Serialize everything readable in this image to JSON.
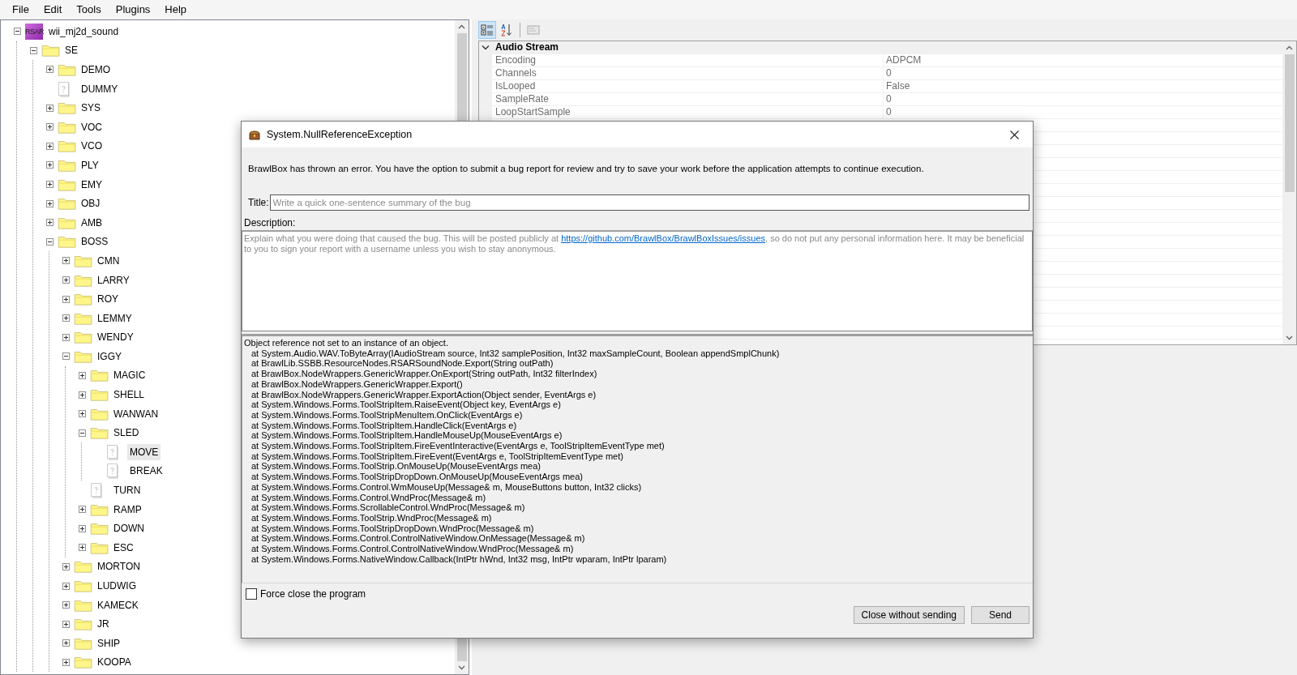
{
  "menu": [
    "File",
    "Edit",
    "Tools",
    "Plugins",
    "Help"
  ],
  "tree": {
    "label": "wii_mj2d_sound",
    "kind": "archive",
    "icon_text": "RSAR",
    "expanded": true,
    "selected": false,
    "children": [
      {
        "label": "SE",
        "kind": "folder",
        "expanded": true,
        "selected": false,
        "children": [
          {
            "label": "DEMO",
            "kind": "folder",
            "expanded": false,
            "selected": false
          },
          {
            "label": "DUMMY",
            "kind": "sound",
            "selected": false
          },
          {
            "label": "SYS",
            "kind": "folder",
            "expanded": false,
            "selected": false
          },
          {
            "label": "VOC",
            "kind": "folder",
            "expanded": false,
            "selected": false
          },
          {
            "label": "VCO",
            "kind": "folder",
            "expanded": false,
            "selected": false
          },
          {
            "label": "PLY",
            "kind": "folder",
            "expanded": false,
            "selected": false
          },
          {
            "label": "EMY",
            "kind": "folder",
            "expanded": false,
            "selected": false
          },
          {
            "label": "OBJ",
            "kind": "folder",
            "expanded": false,
            "selected": false
          },
          {
            "label": "AMB",
            "kind": "folder",
            "expanded": false,
            "selected": false
          },
          {
            "label": "BOSS",
            "kind": "folder",
            "expanded": true,
            "selected": false,
            "children": [
              {
                "label": "CMN",
                "kind": "folder",
                "expanded": false,
                "selected": false
              },
              {
                "label": "LARRY",
                "kind": "folder",
                "expanded": false,
                "selected": false
              },
              {
                "label": "ROY",
                "kind": "folder",
                "expanded": false,
                "selected": false
              },
              {
                "label": "LEMMY",
                "kind": "folder",
                "expanded": false,
                "selected": false
              },
              {
                "label": "WENDY",
                "kind": "folder",
                "expanded": false,
                "selected": false
              },
              {
                "label": "IGGY",
                "kind": "folder",
                "expanded": true,
                "selected": false,
                "children": [
                  {
                    "label": "MAGIC",
                    "kind": "folder",
                    "expanded": false,
                    "selected": false
                  },
                  {
                    "label": "SHELL",
                    "kind": "folder",
                    "expanded": false,
                    "selected": false
                  },
                  {
                    "label": "WANWAN",
                    "kind": "folder",
                    "expanded": false,
                    "selected": false
                  },
                  {
                    "label": "SLED",
                    "kind": "folder",
                    "expanded": true,
                    "selected": false,
                    "children": [
                      {
                        "label": "MOVE",
                        "kind": "sound",
                        "selected": true
                      },
                      {
                        "label": "BREAK",
                        "kind": "sound",
                        "selected": false
                      }
                    ]
                  },
                  {
                    "label": "TURN",
                    "kind": "sound",
                    "selected": false
                  },
                  {
                    "label": "RAMP",
                    "kind": "folder",
                    "expanded": false,
                    "selected": false
                  },
                  {
                    "label": "DOWN",
                    "kind": "folder",
                    "expanded": false,
                    "selected": false
                  },
                  {
                    "label": "ESC",
                    "kind": "folder",
                    "expanded": false,
                    "selected": false
                  }
                ]
              },
              {
                "label": "MORTON",
                "kind": "folder",
                "expanded": false,
                "selected": false
              },
              {
                "label": "LUDWIG",
                "kind": "folder",
                "expanded": false,
                "selected": false
              },
              {
                "label": "KAMECK",
                "kind": "folder",
                "expanded": false,
                "selected": false
              },
              {
                "label": "JR",
                "kind": "folder",
                "expanded": false,
                "selected": false
              },
              {
                "label": "SHIP",
                "kind": "folder",
                "expanded": false,
                "selected": false
              },
              {
                "label": "KOOPA",
                "kind": "folder",
                "expanded": false,
                "selected": false
              }
            ]
          }
        ]
      }
    ]
  },
  "property_grid": {
    "toolbar": [
      {
        "kind": "categorized",
        "selected": true
      },
      {
        "kind": "alphabetical",
        "selected": false
      },
      {
        "kind": "pages",
        "selected": false
      }
    ],
    "categories": [
      {
        "name": "Audio Stream",
        "expanded": true,
        "properties": [
          {
            "name": "Encoding",
            "value": "ADPCM"
          },
          {
            "name": "Channels",
            "value": "0"
          },
          {
            "name": "IsLooped",
            "value": "False"
          },
          {
            "name": "SampleRate",
            "value": "0"
          },
          {
            "name": "LoopStartSample",
            "value": "0"
          }
        ]
      }
    ]
  },
  "dialog": {
    "title": "System.NullReferenceException",
    "message": "BrawlBox has thrown an error. You have the option to submit a bug report for review and try to save your work before the application attempts to continue execution.",
    "title_label": "Title:",
    "title_placeholder": "Write a quick one-sentence summary of the bug",
    "description_label": "Description:",
    "description_hint": {
      "before": "Explain what you were doing that caused the bug. This will be posted publicly at ",
      "link": "https://github.com/BrawlBox/BrawlBoxIssues/issues",
      "after": ", so do not put any personal information here. It may be beneficial to you to sign your report with a username unless you wish to stay anonymous."
    },
    "exception_message": "Object reference not set to an instance of an object.",
    "stack_frames": [
      "at System.Audio.WAV.ToByteArray(IAudioStream source, Int32 samplePosition, Int32 maxSampleCount, Boolean appendSmplChunk)",
      "at BrawlLib.SSBB.ResourceNodes.RSARSoundNode.Export(String outPath)",
      "at BrawlBox.NodeWrappers.GenericWrapper.OnExport(String outPath, Int32 filterIndex)",
      "at BrawlBox.NodeWrappers.GenericWrapper.Export()",
      "at BrawlBox.NodeWrappers.GenericWrapper.ExportAction(Object sender, EventArgs e)",
      "at System.Windows.Forms.ToolStripItem.RaiseEvent(Object key, EventArgs e)",
      "at System.Windows.Forms.ToolStripMenuItem.OnClick(EventArgs e)",
      "at System.Windows.Forms.ToolStripItem.HandleClick(EventArgs e)",
      "at System.Windows.Forms.ToolStripItem.HandleMouseUp(MouseEventArgs e)",
      "at System.Windows.Forms.ToolStripItem.FireEventInteractive(EventArgs e, ToolStripItemEventType met)",
      "at System.Windows.Forms.ToolStripItem.FireEvent(EventArgs e, ToolStripItemEventType met)",
      "at System.Windows.Forms.ToolStrip.OnMouseUp(MouseEventArgs mea)",
      "at System.Windows.Forms.ToolStripDropDown.OnMouseUp(MouseEventArgs mea)",
      "at System.Windows.Forms.Control.WmMouseUp(Message& m, MouseButtons button, Int32 clicks)",
      "at System.Windows.Forms.Control.WndProc(Message& m)",
      "at System.Windows.Forms.ScrollableControl.WndProc(Message& m)",
      "at System.Windows.Forms.ToolStrip.WndProc(Message& m)",
      "at System.Windows.Forms.ToolStripDropDown.WndProc(Message& m)",
      "at System.Windows.Forms.Control.ControlNativeWindow.OnMessage(Message& m)",
      "at System.Windows.Forms.Control.ControlNativeWindow.WndProc(Message& m)",
      "at System.Windows.Forms.NativeWindow.Callback(IntPtr hWnd, Int32 msg, IntPtr wparam, IntPtr lparam)"
    ],
    "force_close": {
      "label": "Force close the program",
      "checked": false
    },
    "buttons": [
      "Close without sending",
      "Send"
    ]
  }
}
